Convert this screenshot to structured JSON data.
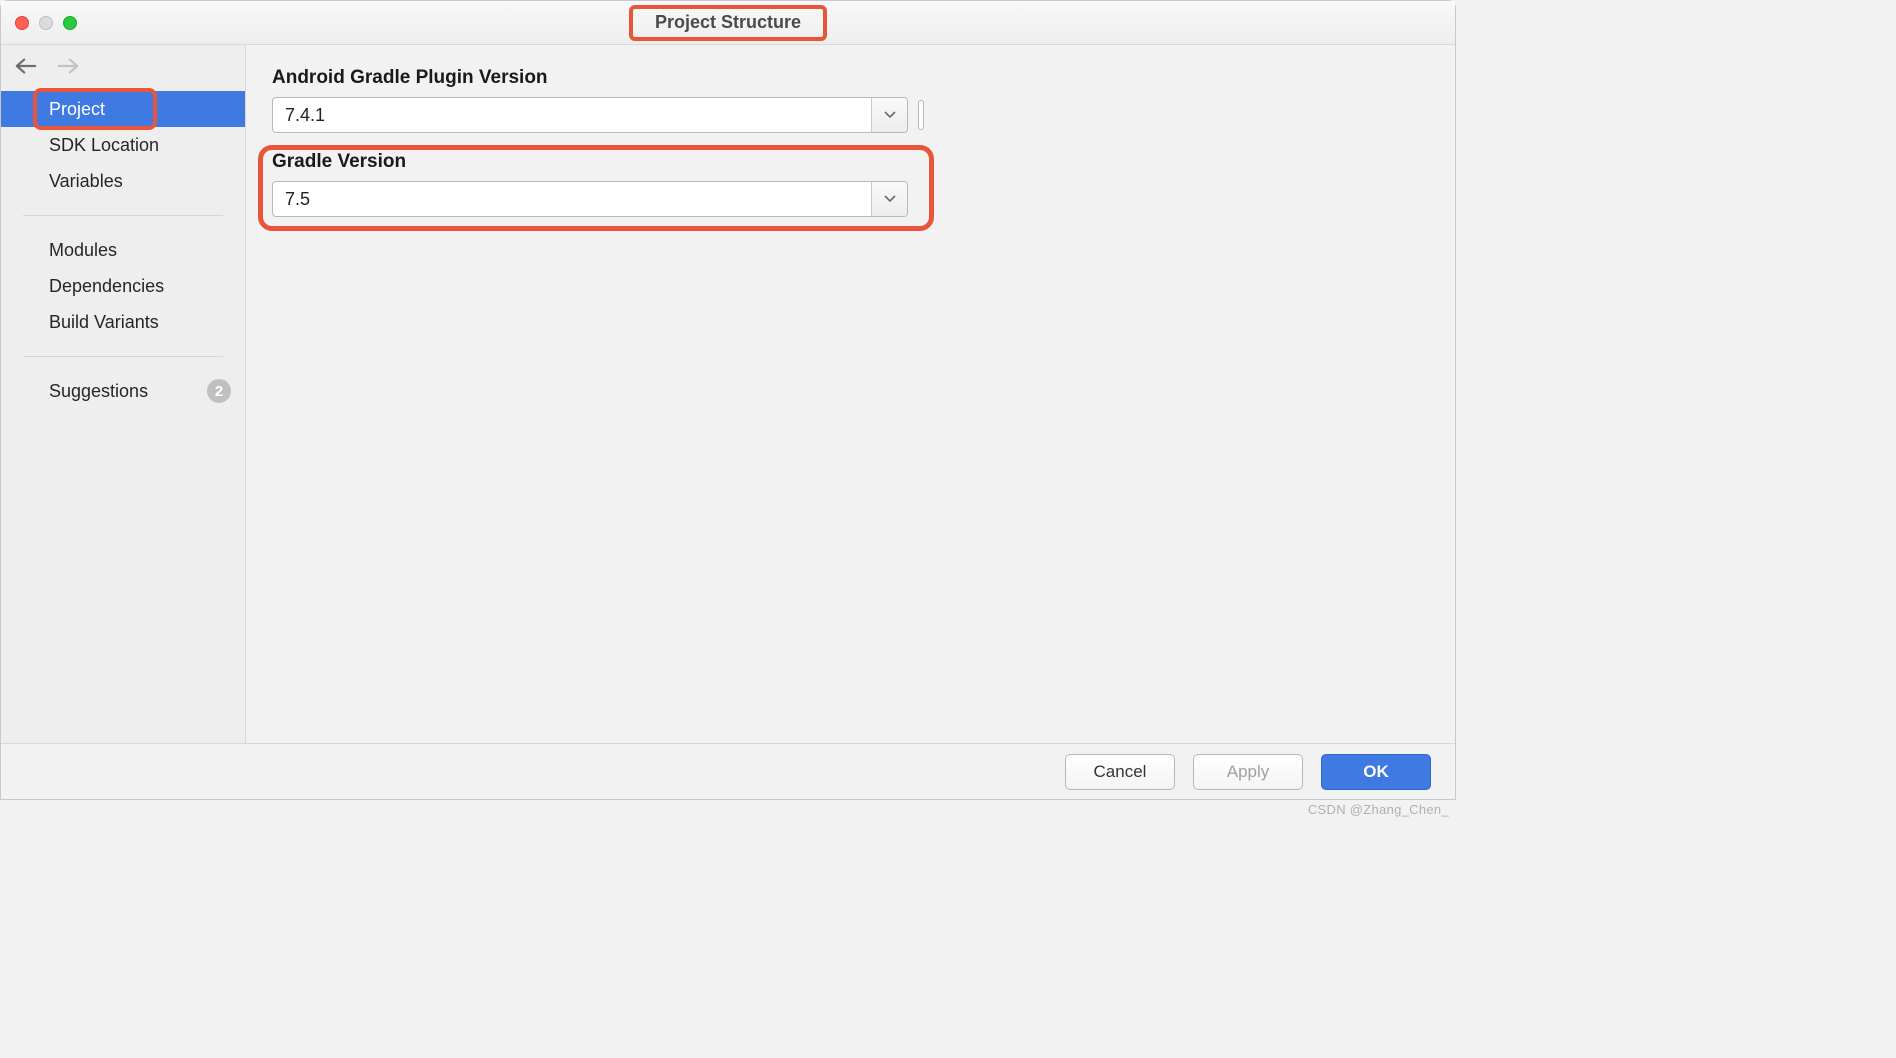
{
  "window": {
    "title": "Project Structure"
  },
  "sidebar": {
    "items": [
      {
        "label": "Project",
        "selected": true
      },
      {
        "label": "SDK Location",
        "selected": false
      },
      {
        "label": "Variables",
        "selected": false
      },
      {
        "label": "Modules",
        "selected": false
      },
      {
        "label": "Dependencies",
        "selected": false
      },
      {
        "label": "Build Variants",
        "selected": false
      },
      {
        "label": "Suggestions",
        "selected": false,
        "badge": "2"
      }
    ]
  },
  "main": {
    "agp_label": "Android Gradle Plugin Version",
    "agp_value": "7.4.1",
    "gradle_label": "Gradle Version",
    "gradle_value": "7.5"
  },
  "footer": {
    "cancel": "Cancel",
    "apply": "Apply",
    "ok": "OK"
  },
  "watermark": "CSDN @Zhang_Chen_",
  "highlights": {
    "title": true,
    "project_item": true,
    "gradle_section": true
  },
  "colors": {
    "highlight_border": "#e8553a",
    "selection_bg": "#3e7ae2",
    "primary_btn": "#3e7ae2"
  }
}
